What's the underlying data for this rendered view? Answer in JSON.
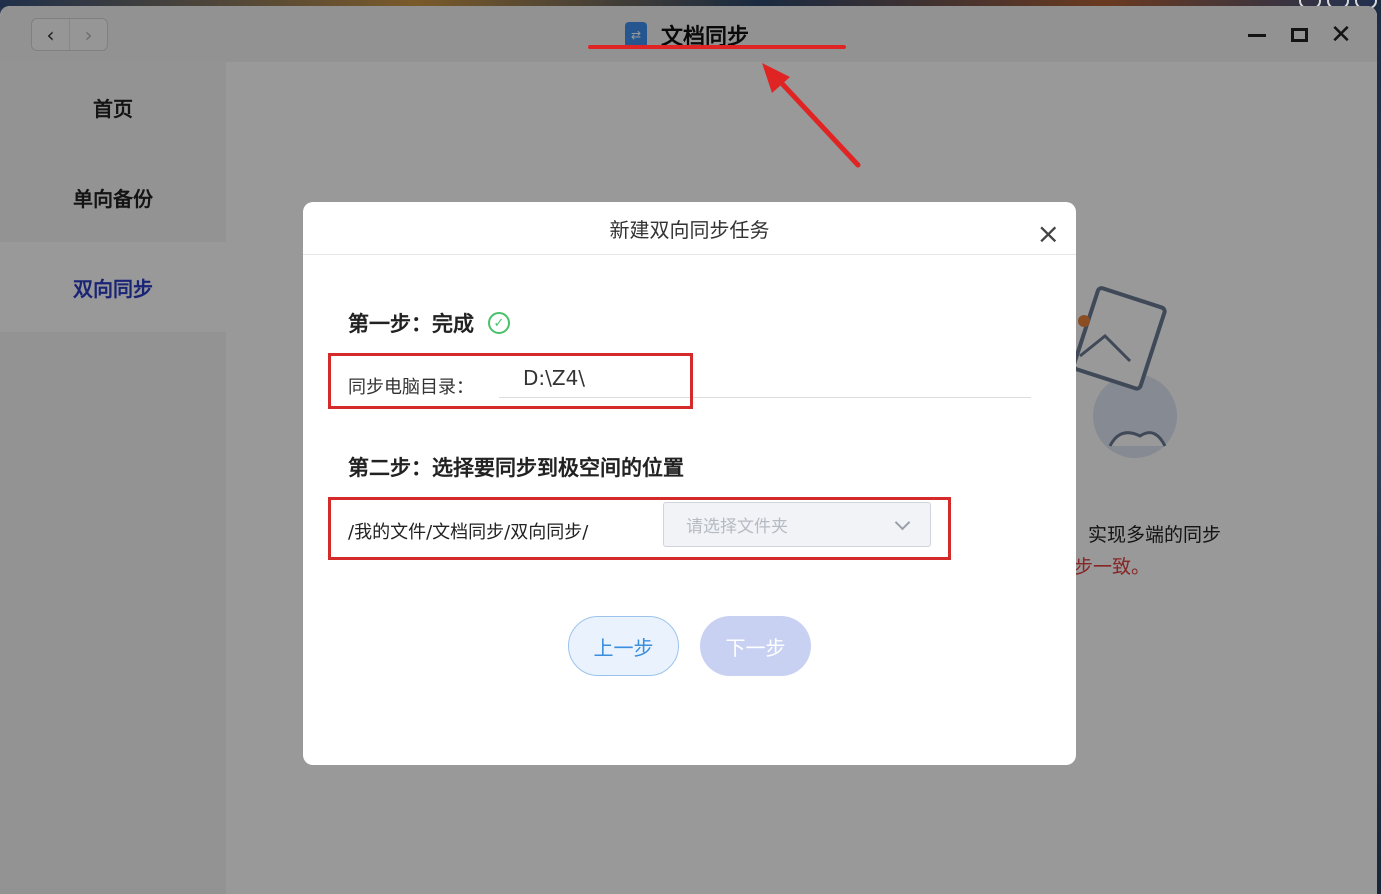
{
  "window": {
    "title": "文档同步",
    "nav_back": "‹",
    "nav_forward": "›",
    "close_glyph": "✕"
  },
  "sidebar": {
    "items": [
      {
        "label": "首页",
        "active": false
      },
      {
        "label": "单向备份",
        "active": false
      },
      {
        "label": "双向同步",
        "active": true
      }
    ]
  },
  "background": {
    "line1": "实现多端的同步",
    "line2": "步一致。"
  },
  "dialog": {
    "title": "新建双向同步任务",
    "close_glyph": "×",
    "step1": {
      "title": "第一步：完成",
      "status_icon": "check-circle-icon",
      "dir_label": "同步电脑目录：",
      "dir_value": "D:\\Z4\\"
    },
    "step2": {
      "title": "第二步：选择要同步到极空间的位置",
      "path": "/我的文件/文档同步/双向同步/",
      "folder_placeholder": "请选择文件夹"
    },
    "buttons": {
      "prev": "上一步",
      "next": "下一步"
    }
  },
  "colors": {
    "accent": "#2b3cc4",
    "annotation": "#d42a2a",
    "success": "#48c26a",
    "link_blue": "#3b8ede"
  }
}
